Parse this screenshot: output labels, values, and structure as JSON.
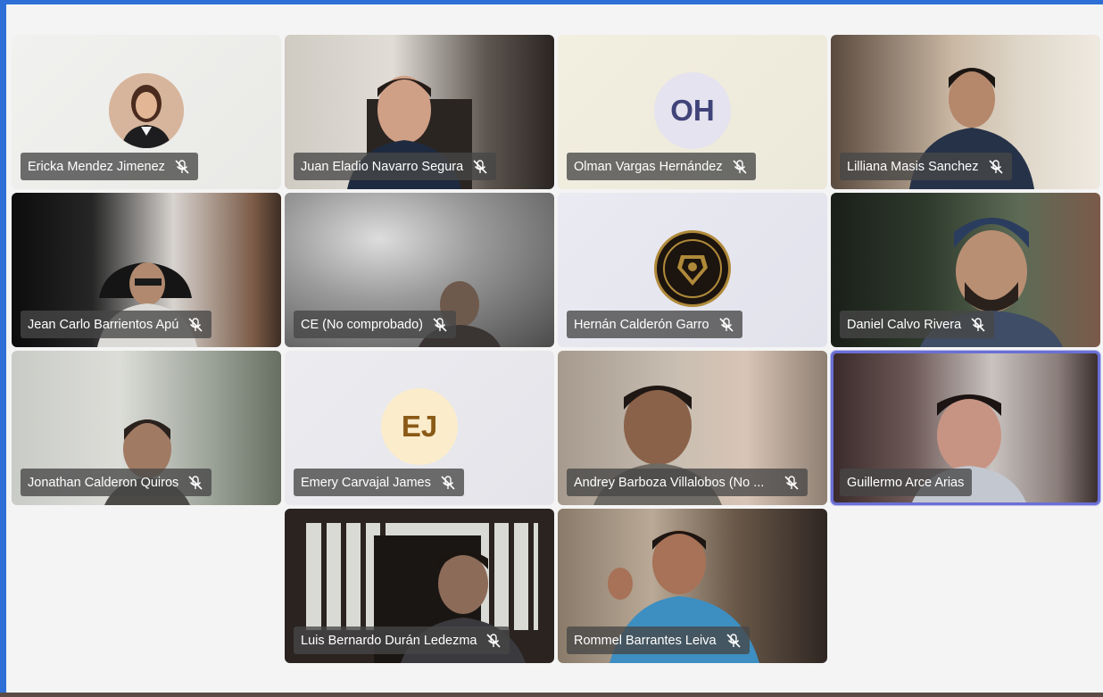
{
  "colors": {
    "window_border": "#2d6fd6",
    "stage_bg": "#f4f4f4",
    "name_tag_bg": "rgba(70,70,70,0.78)",
    "active_border": "#6a6fd6"
  },
  "participants": [
    {
      "name": "Ericka Mendez Jimenez",
      "kind": "photo-avatar",
      "mic": "mic-off-icon"
    },
    {
      "name": "Juan Eladio Navarro Segura",
      "kind": "video",
      "mic": "mic-off-icon"
    },
    {
      "name": "Olman Vargas Hernández",
      "kind": "initials",
      "initials": "OH",
      "mic": "mic-off-icon"
    },
    {
      "name": "Lilliana Masis Sanchez",
      "kind": "video",
      "mic": "mic-off-icon"
    },
    {
      "name": "Jean Carlo Barrientos Apú",
      "kind": "video",
      "mic": "mic-off-icon"
    },
    {
      "name": "CE (No comprobado)",
      "kind": "video",
      "mic": "mic-off-icon"
    },
    {
      "name": "Hernán Calderón Garro",
      "kind": "badge-avatar",
      "mic": "mic-off-icon"
    },
    {
      "name": "Daniel Calvo Rivera",
      "kind": "video",
      "mic": "mic-off-icon"
    },
    {
      "name": "Jonathan Calderon Quiros",
      "kind": "video",
      "mic": "mic-off-icon"
    },
    {
      "name": "Emery Carvajal James",
      "kind": "initials",
      "initials": "EJ",
      "mic": "mic-off-icon"
    },
    {
      "name": "Andrey Barboza Villalobos (No ...",
      "kind": "video",
      "mic": "mic-off-icon"
    },
    {
      "name": "Guillermo Arce Arias",
      "kind": "video",
      "active": true
    },
    {
      "name": "Luis Bernardo Durán Ledezma",
      "kind": "video",
      "mic": "mic-off-icon"
    },
    {
      "name": "Rommel Barrantes Leiva",
      "kind": "video",
      "mic": "mic-off-icon"
    }
  ]
}
